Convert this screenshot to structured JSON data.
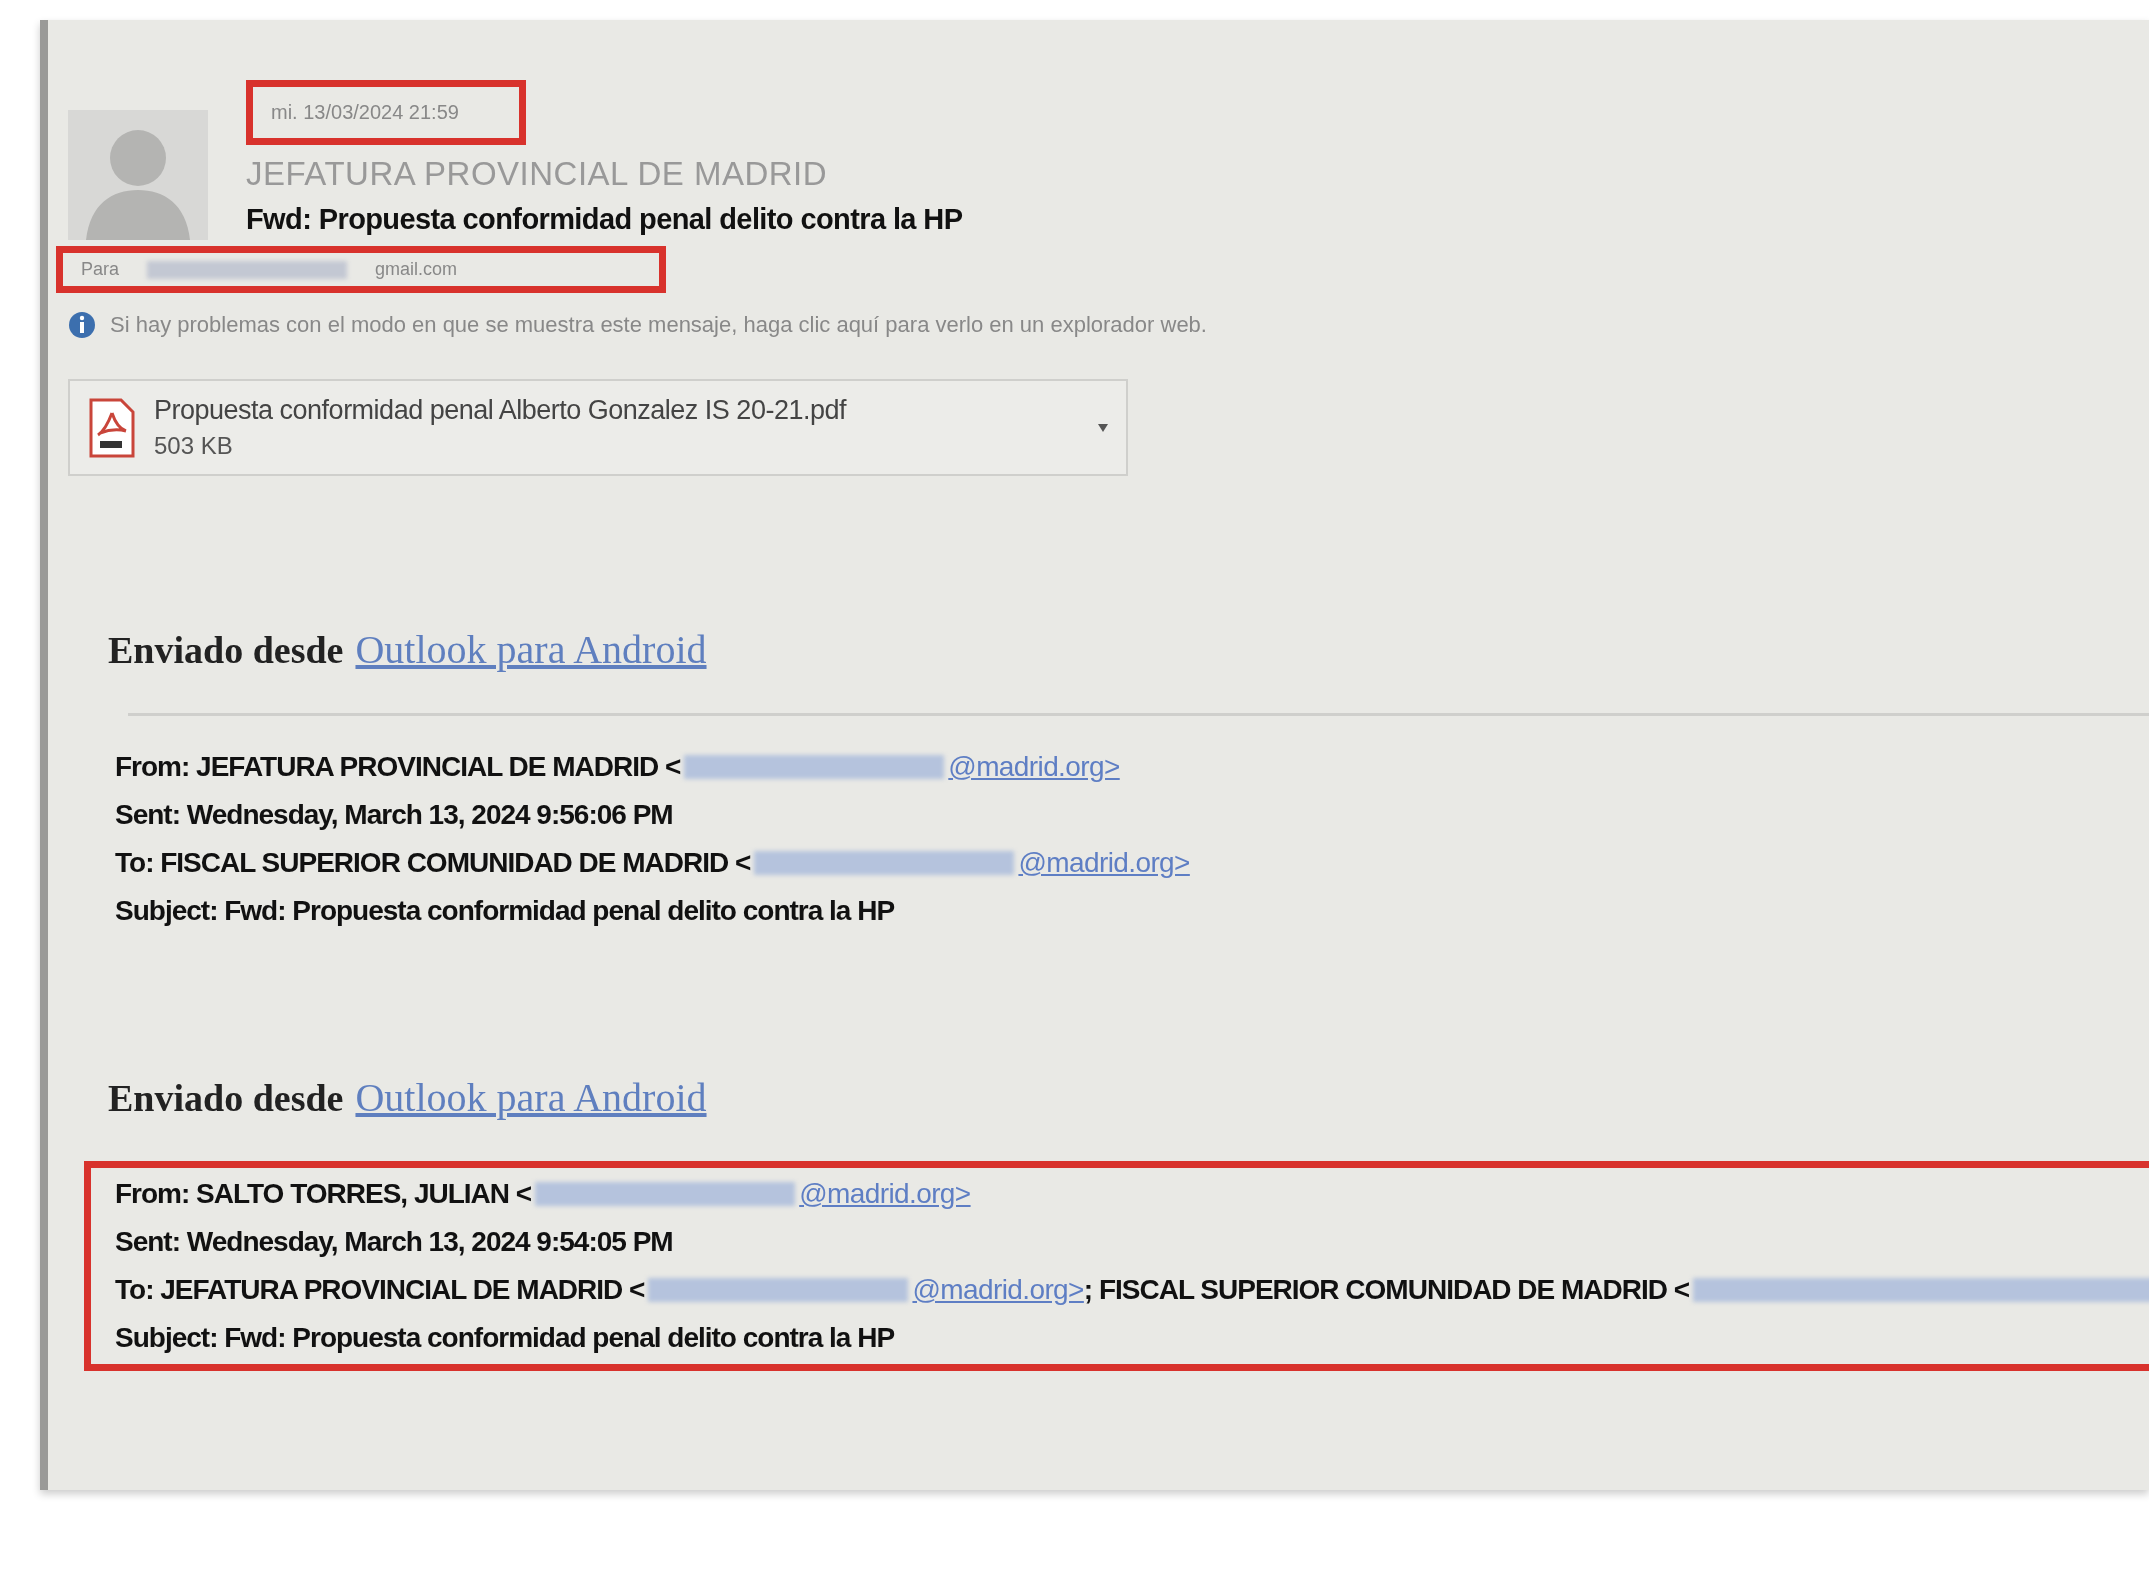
{
  "header": {
    "date": "mi. 13/03/2024 21:59",
    "date_highlighted": true,
    "sender": "JEFATURA PROVINCIAL DE MADRID",
    "subject": "Fwd: Propuesta conformidad penal delito contra la HP",
    "to_label": "Para",
    "to_address_visible": "gmail.com",
    "to_highlighted": true
  },
  "info_message": "Si hay problemas con el modo en que se muestra este mensaje, haga clic aquí para verlo en un explorador web.",
  "attachment": {
    "name": "Propuesta conformidad penal Alberto Gonzalez IS 20-21.pdf",
    "size": "503 KB"
  },
  "forwards": [
    {
      "signature_prefix": "Enviado desde",
      "signature_link": "Outlook para Android",
      "highlighted": false,
      "lines": [
        [
          {
            "kind": "text",
            "text": "From: JEFATURA PROVINCIAL DE MADRID <"
          },
          {
            "kind": "redacted"
          },
          {
            "kind": "link",
            "text": "@madrid.org>"
          }
        ],
        [
          {
            "kind": "text",
            "text": "Sent: Wednesday, March 13, 2024 9:56:06 PM"
          }
        ],
        [
          {
            "kind": "text",
            "text": "To: FISCAL SUPERIOR COMUNIDAD DE MADRID <"
          },
          {
            "kind": "redacted"
          },
          {
            "kind": "link",
            "text": "@madrid.org>"
          }
        ],
        [
          {
            "kind": "text",
            "text": "Subject: Fwd: Propuesta conformidad penal delito contra la HP"
          }
        ]
      ]
    },
    {
      "signature_prefix": "Enviado desde",
      "signature_link": "Outlook para Android",
      "highlighted": true,
      "lines": [
        [
          {
            "kind": "text",
            "text": "From: SALTO TORRES, JULIAN <"
          },
          {
            "kind": "redacted"
          },
          {
            "kind": "link",
            "text": "@madrid.org>"
          }
        ],
        [
          {
            "kind": "text",
            "text": "Sent: Wednesday, March 13, 2024 9:54:05 PM"
          }
        ],
        [
          {
            "kind": "text",
            "text": "To: JEFATURA PROVINCIAL DE MADRID <"
          },
          {
            "kind": "redacted"
          },
          {
            "kind": "link",
            "text": "@madrid.org>"
          },
          {
            "kind": "text",
            "text": "; FISCAL SUPERIOR COMUNIDAD DE MADRID <"
          },
          {
            "kind": "redacted-end"
          }
        ],
        [
          {
            "kind": "text",
            "text": "Subject: Fwd: Propuesta conformidad penal delito contra la HP"
          }
        ]
      ]
    }
  ]
}
